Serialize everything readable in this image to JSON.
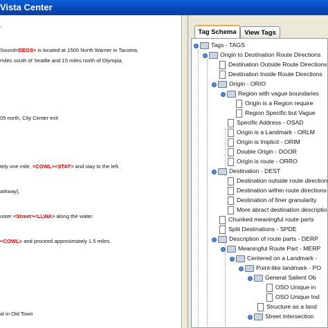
{
  "window": {
    "title": "Vista Center"
  },
  "left_pane": {
    "lines": [
      {
        "text": "-",
        "tags": []
      },
      {
        "text": "Sound",
        "tags": [
          "<DEOS>"
        ],
        "after": " is located at 1500 North Warner in Tacoma,"
      },
      {
        "text": "miles south of Seattle and 15 miles north of Olympia.",
        "tags": []
      },
      {
        "text": "05 north, City Center exit",
        "tags": []
      },
      {
        "text": "tely one mile, ",
        "tags": [
          "<COWL>",
          "<STAT>"
        ],
        "after": " and stay to the left."
      },
      {
        "text": "arkway),",
        "tags": []
      },
      {
        "text": "uster ",
        "tags": [
          "<Street>",
          "<LLWA>"
        ],
        "after": " along the water."
      },
      {
        "text": "",
        "tags": [
          "<COWL>"
        ],
        "after": " and proceed approximately 1.5 miles."
      },
      {
        "text": "al in Old Town",
        "tags": []
      }
    ]
  },
  "tabs": [
    {
      "label": "Tag Schema",
      "active": true
    },
    {
      "label": "View Tags",
      "active": false
    }
  ],
  "tree": {
    "items": [
      {
        "label": "Tags - TAGS",
        "icon": "folder-icon"
      },
      {
        "label": "Origin to Destination Route Directions",
        "icon": "folder-icon"
      },
      {
        "label": "Destination Outside Route Directions",
        "icon": "document-icon"
      },
      {
        "label": "Destination Inside Route Directions",
        "icon": "document-icon"
      },
      {
        "label": "Origin - ORIO",
        "icon": "folder-icon"
      },
      {
        "label": "Region with vague boundaries",
        "icon": "folder-icon"
      },
      {
        "label": "Origin is a Region require",
        "icon": "document-icon"
      },
      {
        "label": "Region Specific but Vague",
        "icon": "document-icon"
      },
      {
        "label": "Specific Address - OSAD",
        "icon": "document-icon"
      },
      {
        "label": "Origin is a Landmark - ORLM",
        "icon": "document-icon"
      },
      {
        "label": "Origin is Implicit - ORIM",
        "icon": "document-icon"
      },
      {
        "label": "Double Origin - DOOR",
        "icon": "document-icon"
      },
      {
        "label": "Origin is route - ORRO",
        "icon": "document-icon"
      },
      {
        "label": "Destination - DEST",
        "icon": "folder-icon"
      },
      {
        "label": "Destination outside route directions",
        "icon": "document-icon"
      },
      {
        "label": "Destination within route directions",
        "icon": "document-icon"
      },
      {
        "label": "Destination of finer granularity",
        "icon": "document-icon"
      },
      {
        "label": "More abract destination descriptions",
        "icon": "document-icon"
      },
      {
        "label": "Chunked meaningful route parts",
        "icon": "document-icon"
      },
      {
        "label": "Split Destinations - SPDE",
        "icon": "document-icon"
      },
      {
        "label": "Description of route parts - DERP",
        "icon": "folder-icon"
      },
      {
        "label": "Meaningful Route Part - MERP",
        "icon": "folder-icon"
      },
      {
        "label": "Centered on a Landmark -",
        "icon": "folder-icon"
      },
      {
        "label": "Point-like landmark - PO",
        "icon": "folder-icon"
      },
      {
        "label": "General Salient Ob",
        "icon": "folder-icon"
      },
      {
        "label": "OSO Unique in",
        "icon": "document-icon"
      },
      {
        "label": "OSO Unique Ind",
        "icon": "document-icon"
      },
      {
        "label": "Structure as a land",
        "icon": "document-icon"
      },
      {
        "label": "Street Intersection",
        "icon": "folder-icon"
      }
    ]
  }
}
